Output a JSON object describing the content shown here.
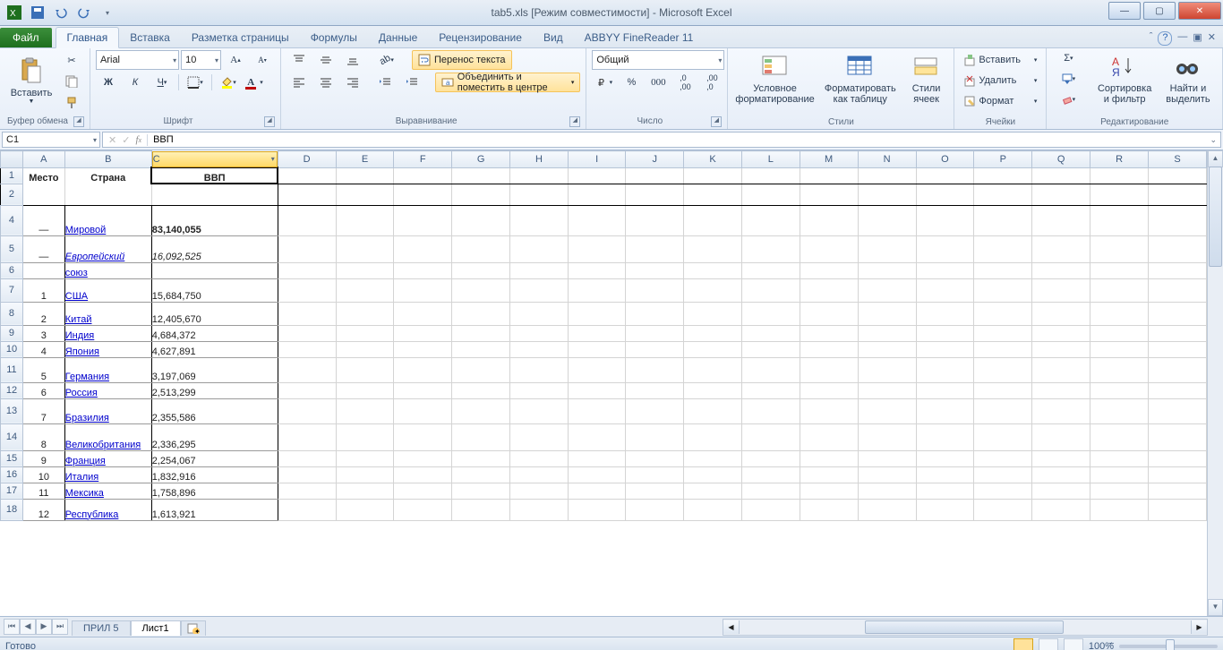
{
  "title": "tab5.xls  [Режим совместимости]  -  Microsoft Excel",
  "tabs": {
    "file": "Файл",
    "home": "Главная",
    "insert": "Вставка",
    "layout": "Разметка страницы",
    "formulas": "Формулы",
    "data": "Данные",
    "review": "Рецензирование",
    "view": "Вид",
    "abbyy": "ABBYY FineReader 11"
  },
  "ribbon": {
    "clipboard": {
      "paste": "Вставить",
      "label": "Буфер обмена"
    },
    "font": {
      "name": "Arial",
      "size": "10",
      "label": "Шрифт",
      "bold": "Ж",
      "italic": "К",
      "underline": "Ч"
    },
    "align": {
      "wrap": "Перенос текста",
      "merge": "Объединить и поместить в центре",
      "label": "Выравнивание"
    },
    "number": {
      "format": "Общий",
      "label": "Число"
    },
    "styles": {
      "cond": "Условное форматирование",
      "table": "Форматировать как таблицу",
      "cell": "Стили ячеек",
      "label": "Стили"
    },
    "cells": {
      "insert": "Вставить",
      "delete": "Удалить",
      "format": "Формат",
      "label": "Ячейки"
    },
    "editing": {
      "sort": "Сортировка и фильтр",
      "find": "Найти и выделить",
      "label": "Редактирование"
    }
  },
  "namebox": "C1",
  "formula": "ВВП",
  "columns": [
    "A",
    "B",
    "C",
    "D",
    "E",
    "F",
    "G",
    "H",
    "I",
    "J",
    "K",
    "L",
    "M",
    "N",
    "O",
    "P",
    "Q",
    "R",
    "S"
  ],
  "headers": {
    "place": "Место",
    "country": "Страна",
    "gdp": "ВВП"
  },
  "rows": [
    {
      "n": "4",
      "place": "—",
      "country": "Мировой",
      "gdp": "83,140,055",
      "bold": true
    },
    {
      "n": "5",
      "place": "—",
      "country": "Европейский",
      "gdp": "16,092,525",
      "italic": true
    },
    {
      "n": "6",
      "place": "",
      "country": "союз",
      "gdp": ""
    },
    {
      "n": "7",
      "place": "1",
      "country": "США",
      "gdp": "15,684,750"
    },
    {
      "n": "8",
      "place": "2",
      "country": "Китай",
      "gdp": "12,405,670"
    },
    {
      "n": "9",
      "place": "3",
      "country": "Индия",
      "gdp": "4,684,372"
    },
    {
      "n": "10",
      "place": "4",
      "country": "Япония",
      "gdp": "4,627,891"
    },
    {
      "n": "11",
      "place": "5",
      "country": "Германия",
      "gdp": "3,197,069"
    },
    {
      "n": "12",
      "place": "6",
      "country": "Россия",
      "gdp": "2,513,299"
    },
    {
      "n": "13",
      "place": "7",
      "country": "Бразилия",
      "gdp": "2,355,586"
    },
    {
      "n": "14",
      "place": "8",
      "country": "Великобритания",
      "gdp": "2,336,295"
    },
    {
      "n": "15",
      "place": "9",
      "country": "Франция",
      "gdp": "2,254,067"
    },
    {
      "n": "16",
      "place": "10",
      "country": "Италия",
      "gdp": "1,832,916"
    },
    {
      "n": "17",
      "place": "11",
      "country": "Мексика",
      "gdp": "1,758,896"
    },
    {
      "n": "18",
      "place": "12",
      "country": "Республика",
      "gdp": "1,613,921"
    }
  ],
  "sheets": {
    "s1": "ПРИЛ 5",
    "s2": "Лист1"
  },
  "status": {
    "ready": "Готово",
    "zoom": "100%"
  }
}
